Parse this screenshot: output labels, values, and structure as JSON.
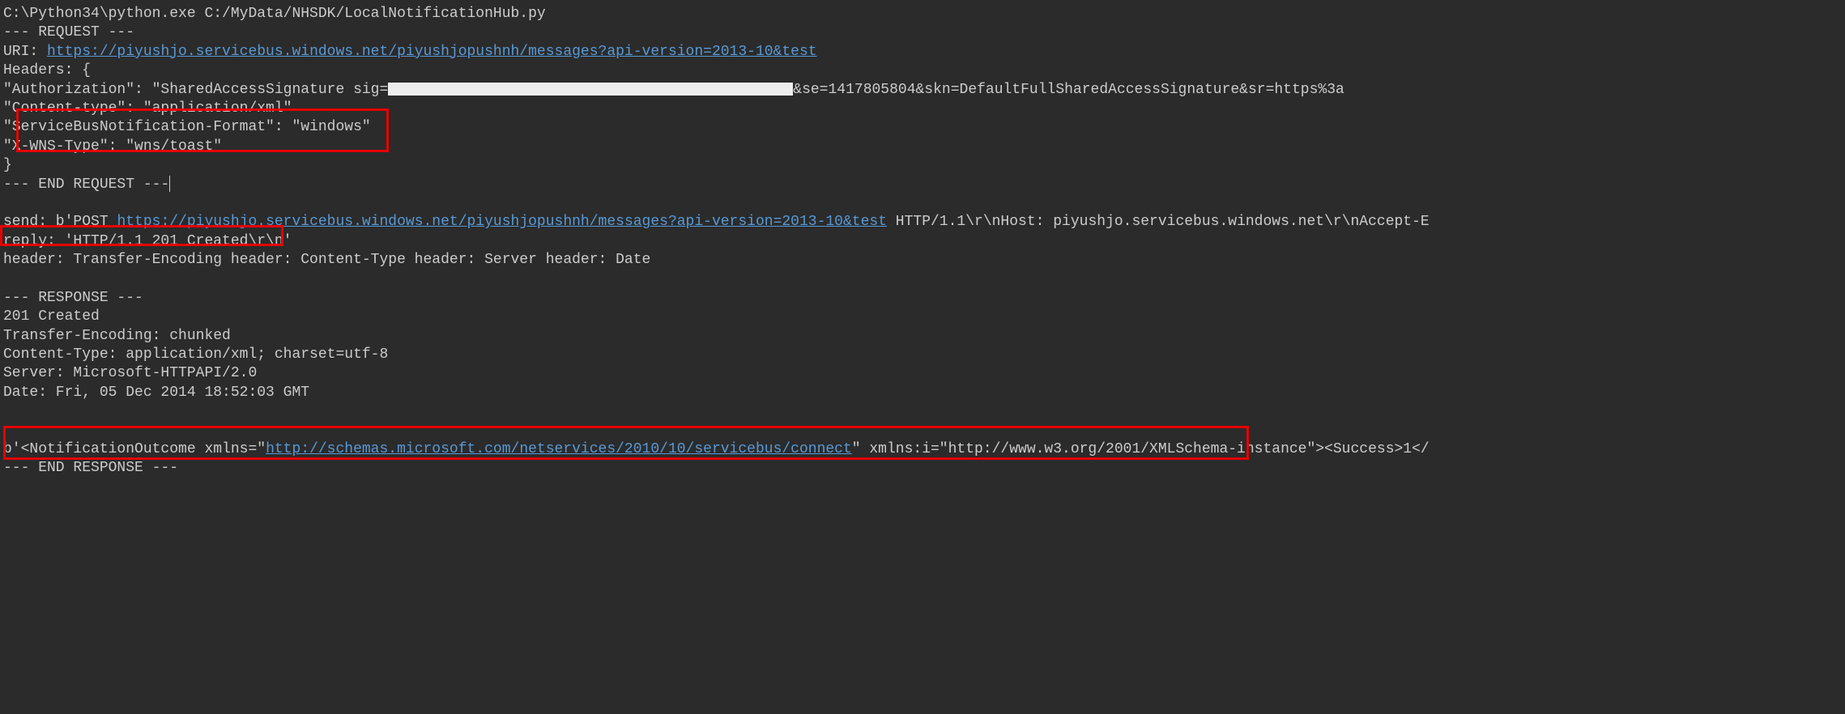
{
  "command": "C:\\Python34\\python.exe C:/MyData/NHSDK/LocalNotificationHub.py",
  "request_start": "--- REQUEST ---",
  "uri_label": "URI: ",
  "uri_link": "https://piyushjo.servicebus.windows.net/piyushjopushnh/messages?api-version=2013-10&test",
  "headers_open": "Headers: {",
  "auth_key": "    \"Authorization\": \"SharedAccessSignature sig=",
  "auth_rest": "&se=1417805804&skn=DefaultFullSharedAccessSignature&sr=https%3a",
  "content_type": "    \"Content-type\": \"application/xml\"",
  "sbn_format": "    \"ServiceBusNotification-Format\": \"windows\"",
  "wns_type": "    \"X-WNS-Type\": \"wns/toast\"",
  "brace_close": "}",
  "end_request": "--- END REQUEST ---",
  "send_prefix": "send: b'POST ",
  "send_link": "https://piyushjo.servicebus.windows.net/piyushjopushnh/messages?api-version=2013-10&test",
  "send_suffix": " HTTP/1.1\\r\\nHost: piyushjo.servicebus.windows.net\\r\\nAccept-E",
  "reply": "reply: 'HTTP/1.1 201 Created\\r\\n'",
  "header_line": "header: Transfer-Encoding header: Content-Type header: Server header: Date",
  "response_start": "--- RESPONSE ---",
  "status": "201 Created",
  "transfer_encoding": "Transfer-Encoding: chunked",
  "resp_content_type": "Content-Type: application/xml; charset=utf-8",
  "server": "Server: Microsoft-HTTPAPI/2.0",
  "date": "Date: Fri, 05 Dec 2014 18:52:03 GMT",
  "outcome_prefix": "b'<NotificationOutcome xmlns=\"",
  "outcome_link": "http://schemas.microsoft.com/netservices/2010/10/servicebus/connect",
  "outcome_suffix": "\" xmlns:i=\"http://www.w3.org/2001/XMLSchema-instance\"><Success>1</",
  "end_response": "--- END RESPONSE ---"
}
